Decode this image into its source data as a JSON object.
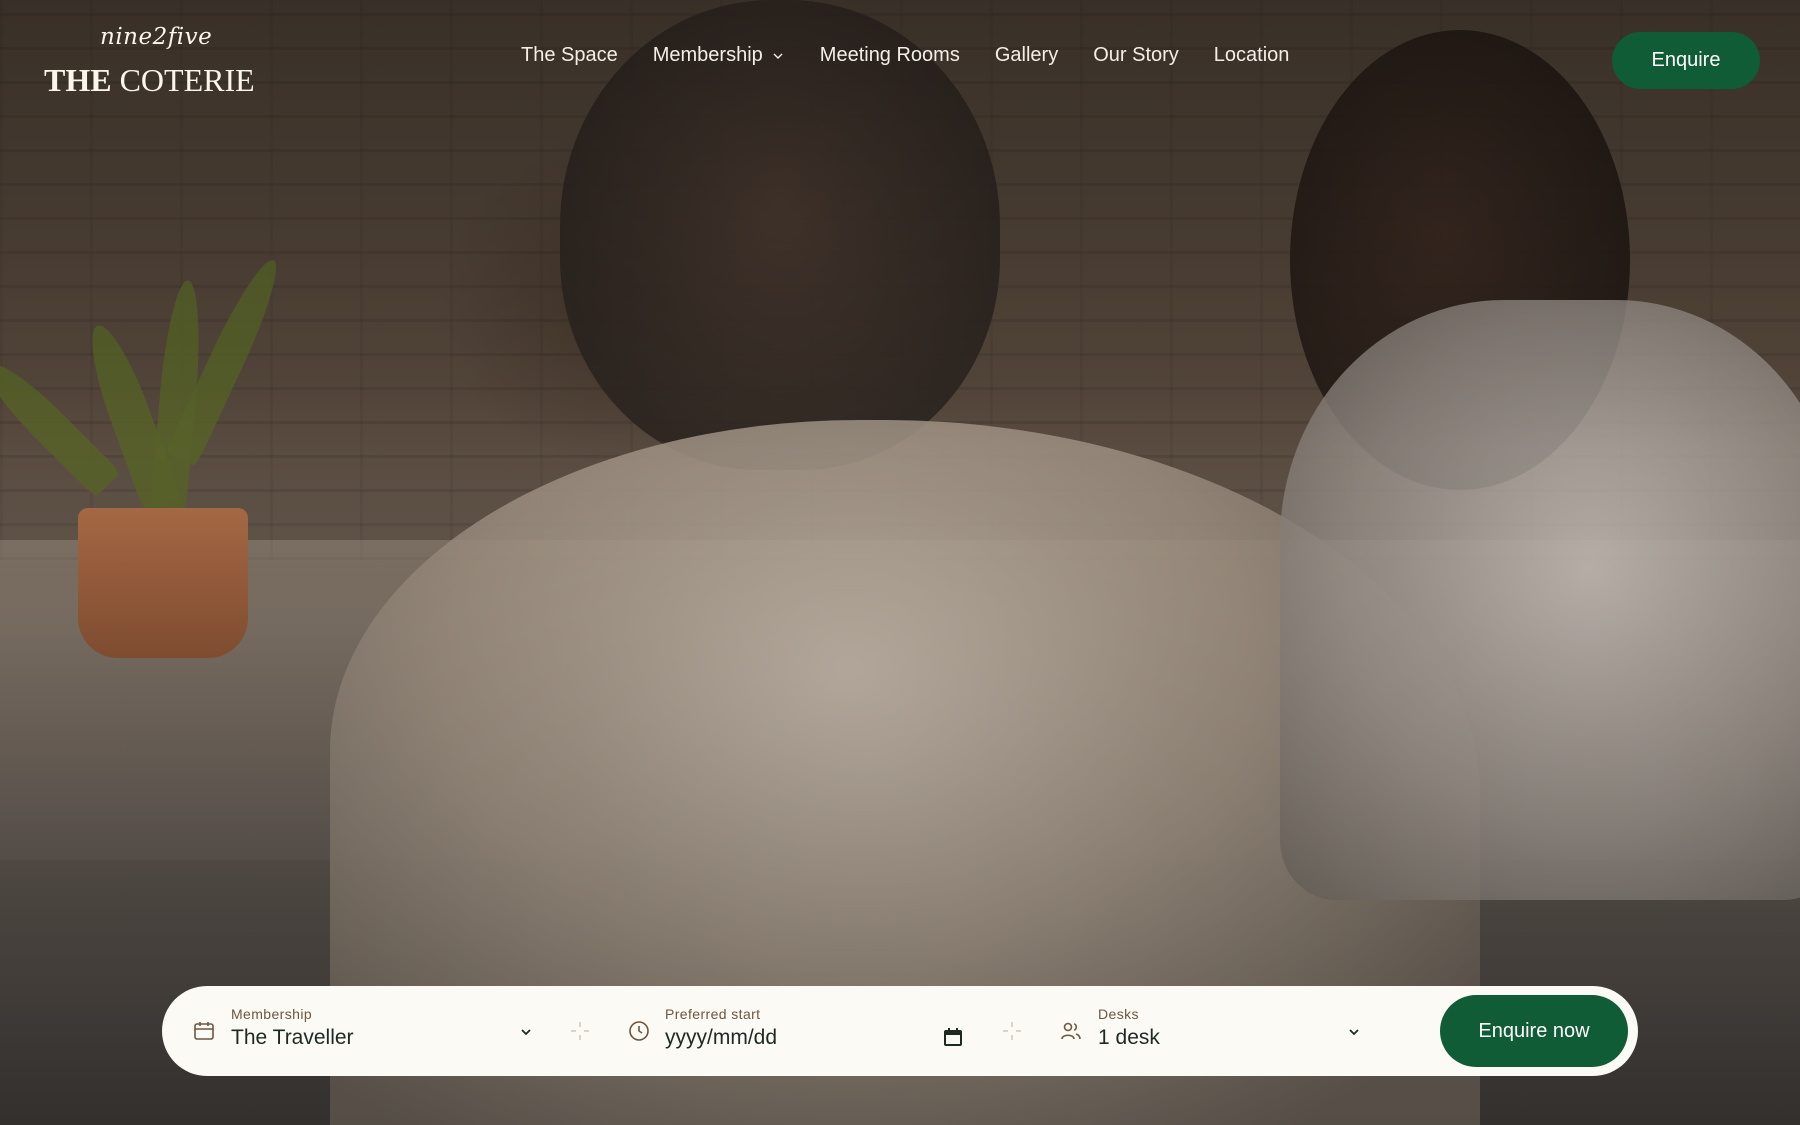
{
  "brand": {
    "script": "nine2five",
    "name_bold": "THE",
    "name_regular": "COTERIE"
  },
  "nav": {
    "items": [
      {
        "label": "The Space"
      },
      {
        "label": "Membership",
        "has_dropdown": true
      },
      {
        "label": "Meeting Rooms"
      },
      {
        "label": "Gallery"
      },
      {
        "label": "Our Story"
      },
      {
        "label": "Location"
      }
    ],
    "cta_label": "Enquire"
  },
  "booking": {
    "membership": {
      "label": "Membership",
      "value": "The Traveller",
      "icon": "calendar-icon"
    },
    "start": {
      "label": "Preferred start",
      "placeholder": "yyyy/mm/dd",
      "icon": "clock-icon"
    },
    "desks": {
      "label": "Desks",
      "value": "1 desk",
      "icon": "people-icon"
    },
    "submit_label": "Enquire now"
  },
  "colors": {
    "brand_green": "#0f5c36",
    "bar_background": "#fbfaf4",
    "label_brown": "#6e5640"
  }
}
